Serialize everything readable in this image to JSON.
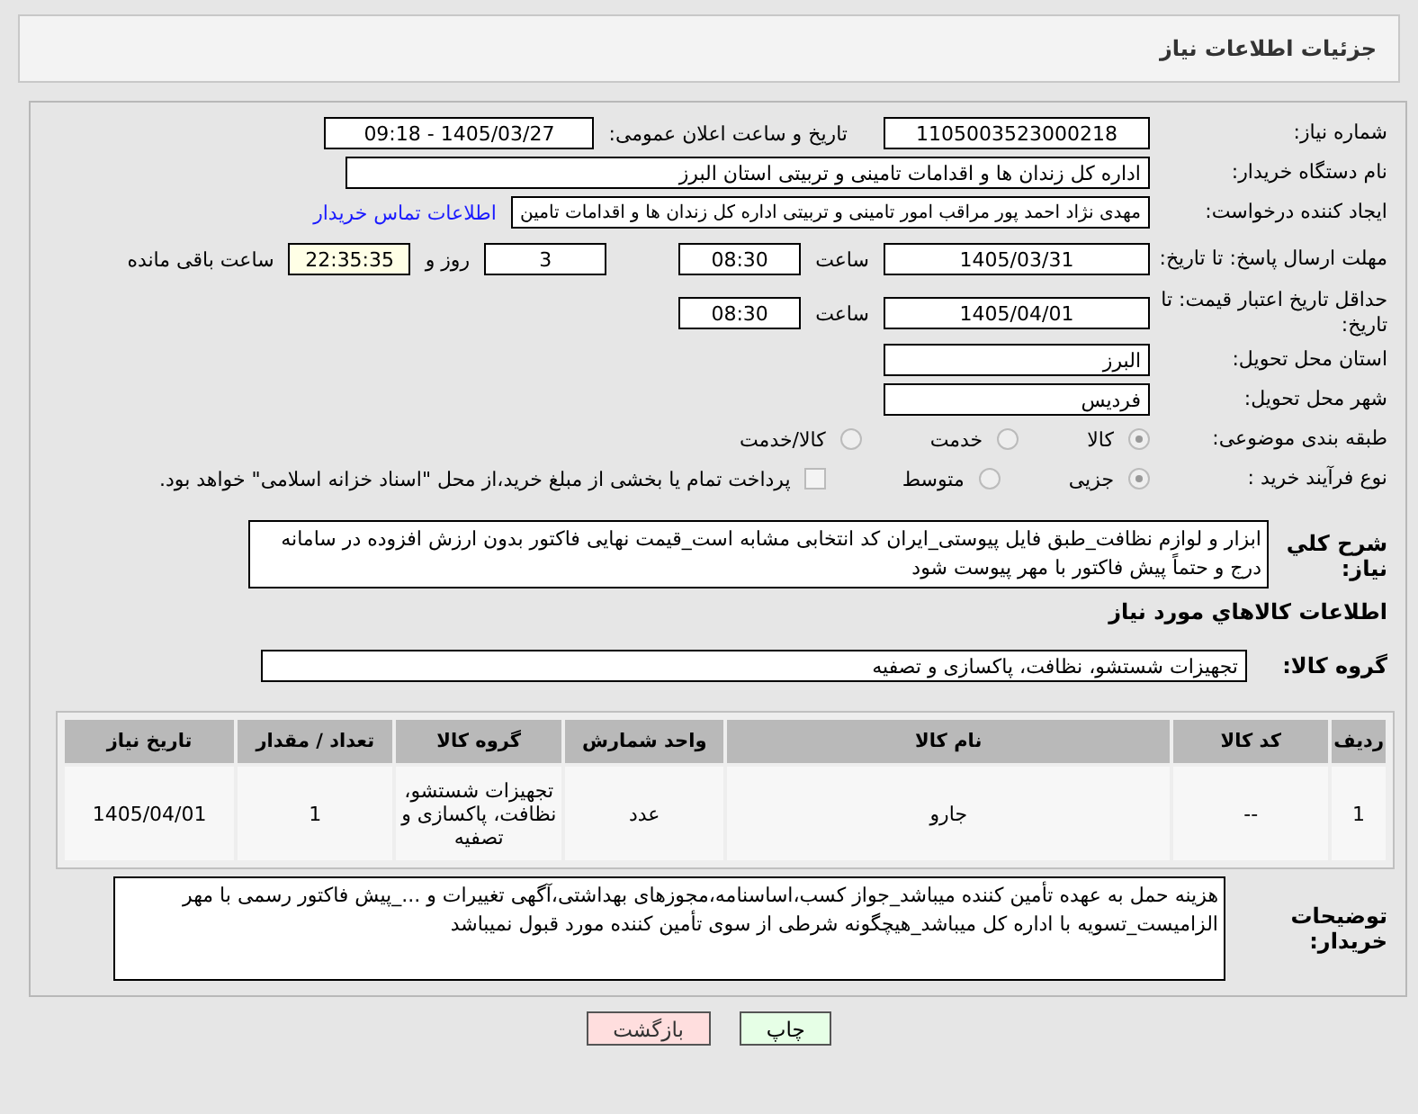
{
  "header": {
    "title": "جزئیات اطلاعات نیاز"
  },
  "need_number": {
    "label": "شماره نیاز:",
    "value": "1105003523000218"
  },
  "announce": {
    "label": "تاریخ و ساعت اعلان عمومی:",
    "value": "1405/03/27 - 09:18"
  },
  "buyer_org": {
    "label": "نام دستگاه خریدار:",
    "value": "اداره کل زندان ها و اقدامات تامینی و تربیتی استان البرز"
  },
  "creator": {
    "label": "ایجاد کننده درخواست:",
    "value": "مهدی نژاد احمد پور مراقب امور تامینی و تربیتی اداره کل زندان ها و اقدامات تامین",
    "link": "اطلاعات تماس خریدار"
  },
  "deadline": {
    "label": "مهلت ارسال پاسخ: تا تاریخ:",
    "date": "1405/03/31",
    "time_label": "ساعت",
    "time": "08:30",
    "days": "3",
    "days_label": "روز و",
    "remaining": "22:35:35",
    "remaining_label": "ساعت باقی مانده"
  },
  "validity": {
    "label": "حداقل تاریخ اعتبار قیمت: تا تاریخ:",
    "date": "1405/04/01",
    "time_label": "ساعت",
    "time": "08:30"
  },
  "province": {
    "label": "استان محل تحویل:",
    "value": "البرز"
  },
  "city": {
    "label": "شهر محل تحویل:",
    "value": "فردیس"
  },
  "category": {
    "label": "طبقه بندی موضوعی:",
    "options": [
      {
        "label": "کالا",
        "selected": true
      },
      {
        "label": "خدمت",
        "selected": false
      },
      {
        "label": "کالا/خدمت",
        "selected": false
      }
    ]
  },
  "process": {
    "label": "نوع فرآیند خرید :",
    "options": [
      {
        "label": "جزیی",
        "selected": true
      },
      {
        "label": "متوسط",
        "selected": false
      }
    ],
    "payment": {
      "label": "پرداخت تمام یا بخشی از مبلغ خرید،از محل \"اسناد خزانه اسلامی\" خواهد بود.",
      "checked": false
    }
  },
  "description": {
    "label": "شرح کلي نياز:",
    "value": "ابزار و لوازم نظافت_طبق فایل پیوستی_ایران کد انتخابی مشابه است_قیمت نهایی فاکتور بدون ارزش افزوده در سامانه درج و حتماً پیش فاکتور با مهر پیوست شود"
  },
  "goods_title": "اطلاعات کالاهاي مورد نياز",
  "goods_group": {
    "label": "گروه کالا:",
    "value": "تجهیزات شستشو، نظافت، پاکسازی و تصفیه"
  },
  "table": {
    "columns": [
      "ردیف",
      "کد کالا",
      "نام کالا",
      "واحد شمارش",
      "گروه کالا",
      "تعداد / مقدار",
      "تاریخ نیاز"
    ],
    "rows": [
      [
        "1",
        "--",
        "جارو",
        "عدد",
        "تجهیزات شستشو، نظافت، پاکسازی و تصفیه",
        "1",
        "1405/04/01"
      ]
    ]
  },
  "buyer_notes": {
    "label": "توضیحات خریدار:",
    "value": "هزینه حمل به عهده تأمین کننده میباشد_جواز کسب،اساسنامه،مجوزهای بهداشتی،آگهی تغییرات و ..._پیش فاکتور رسمی با مهر الزامیست_تسویه با اداره کل میباشد_هیچگونه شرطی از سوی تأمین کننده مورد قبول نمیباشد"
  },
  "buttons": [
    {
      "label": "چاپ",
      "kind": "print"
    },
    {
      "label": "بازگشت",
      "kind": "back"
    }
  ]
}
